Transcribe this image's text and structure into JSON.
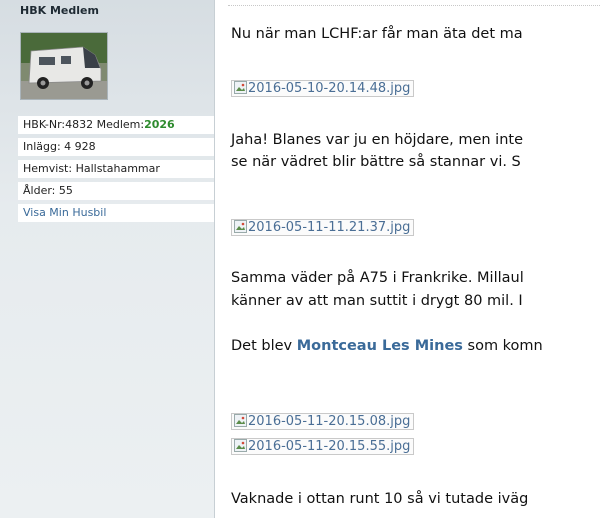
{
  "sidebar": {
    "rank": "HBK Medlem",
    "info": {
      "member": "HBK-Nr:4832 Medlem:",
      "member_year": "2026",
      "posts": "Inlägg: 4 928",
      "home": "Hemvist: Hallstahammar",
      "age": "Ålder: 55",
      "link": "Visa Min Husbil"
    }
  },
  "post": {
    "line1": "Nu när man LCHF:ar får man äta det ma",
    "img1": "2016-05-10-20.14.48.jpg",
    "line2a": "Jaha! Blanes var ju en höjdare, men inte",
    "line2b": "se när vädret blir bättre så stannar vi. S",
    "img2": "2016-05-11-11.21.37.jpg",
    "line3a": "Samma väder på A75 i Frankrike. Millaul",
    "line3b": "känner av att man suttit i drygt 80 mil. I",
    "line4_pre": "Det blev ",
    "line4_link": "Montceau Les Mines",
    "line4_post": " som komn",
    "img3": "2016-05-11-20.15.08.jpg",
    "img4": "2016-05-11-20.15.55.jpg",
    "line5": "Vaknade i ottan runt 10 så vi tutade iväg"
  }
}
